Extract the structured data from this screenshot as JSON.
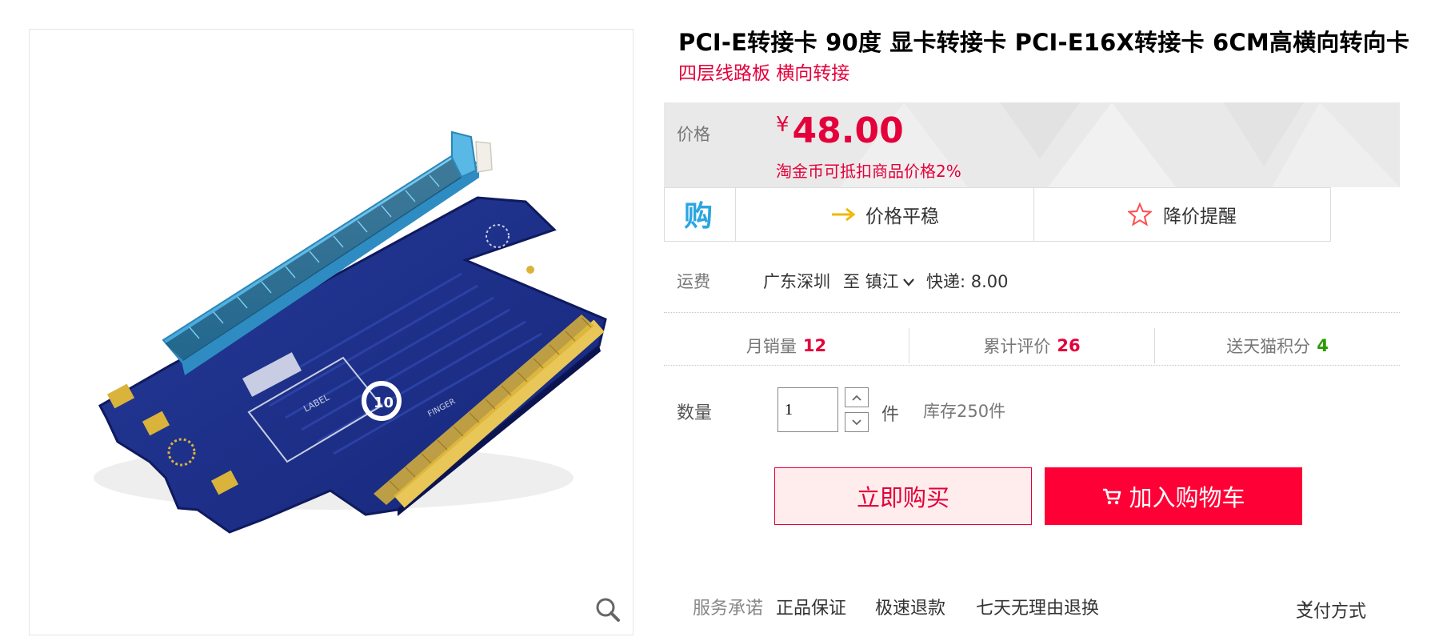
{
  "product": {
    "title": "PCI-E转接卡 90度 显卡转接卡 PCI-E16X转接卡 6CM高横向转向卡",
    "subtitle": "四层线路板 横向转接"
  },
  "gallery": {
    "zoom_icon": "search-icon"
  },
  "price": {
    "label": "价格",
    "currency": "¥",
    "value": "48.00",
    "note": "淘金币可抵扣商品价格2%"
  },
  "trend": {
    "buy_icon": "gou-buy-icon",
    "stable_label": "价格平稳",
    "stable_icon": "arrow-right-icon",
    "remind_label": "降价提醒",
    "remind_icon": "star-outline-icon"
  },
  "shipping": {
    "label": "运费",
    "from": "广东深圳",
    "to": "至 镇江",
    "express": "快递: 8.00"
  },
  "stats": {
    "monthly_sales_label": "月销量",
    "monthly_sales_value": "12",
    "reviews_label": "累计评价",
    "reviews_value": "26",
    "points_label": "送天猫积分",
    "points_value": "4"
  },
  "quantity": {
    "label": "数量",
    "value": "1",
    "unit": "件",
    "stock": "库存250件"
  },
  "actions": {
    "buy_now": "立即购买",
    "add_cart": "加入购物车",
    "cart_icon": "cart-icon"
  },
  "service": {
    "label": "服务承诺",
    "items": [
      "正品保证",
      "极速退款",
      "七天无理由退换"
    ],
    "payment": "支付方式"
  },
  "colors": {
    "accent": "#ff0036",
    "price_red": "#e4003a",
    "green": "#2c9a00",
    "pcb_blue": "#1d2f86",
    "slot_blue": "#5ab8e6",
    "gold": "#d9b33a"
  }
}
